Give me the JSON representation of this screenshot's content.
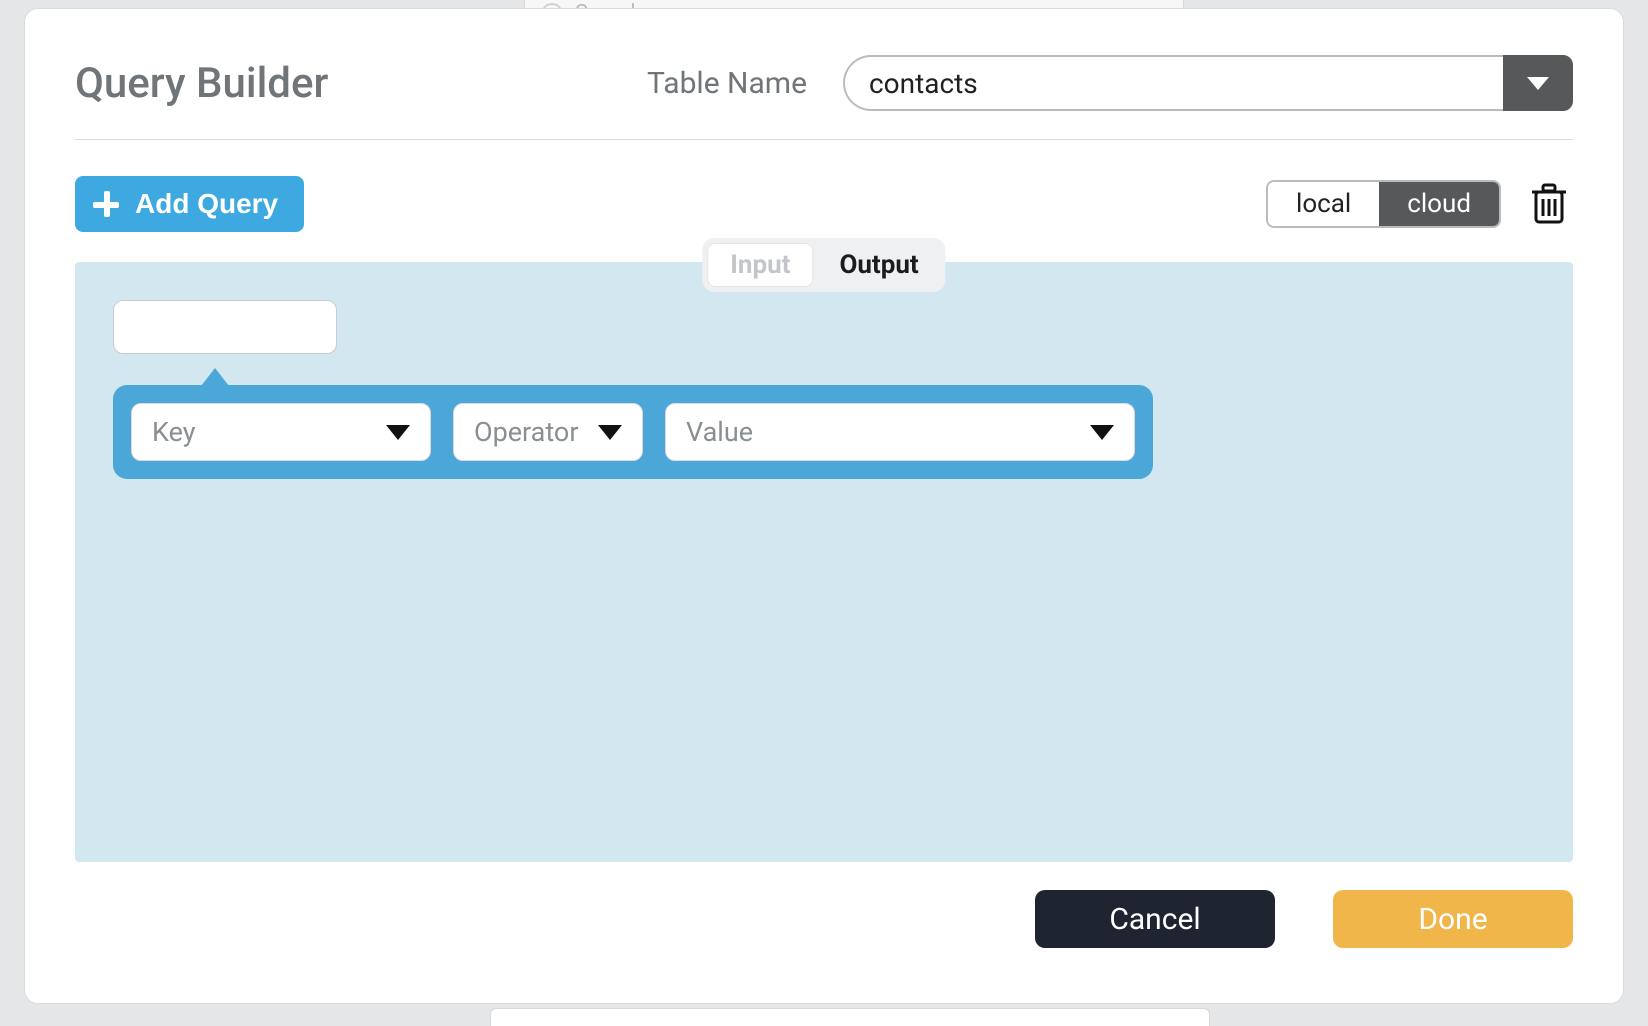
{
  "bg": {
    "search_placeholder": "Search"
  },
  "header": {
    "title": "Query Builder",
    "table_label": "Table Name",
    "table_value": "contacts"
  },
  "toolbar": {
    "add_query_label": "Add Query",
    "segments": {
      "local": "local",
      "cloud": "cloud"
    }
  },
  "tabs": {
    "input": "Input",
    "output": "Output",
    "active": "output"
  },
  "condition": {
    "key_placeholder": "Key",
    "operator_placeholder": "Operator",
    "value_placeholder": "Value"
  },
  "footer": {
    "cancel": "Cancel",
    "done": "Done"
  }
}
